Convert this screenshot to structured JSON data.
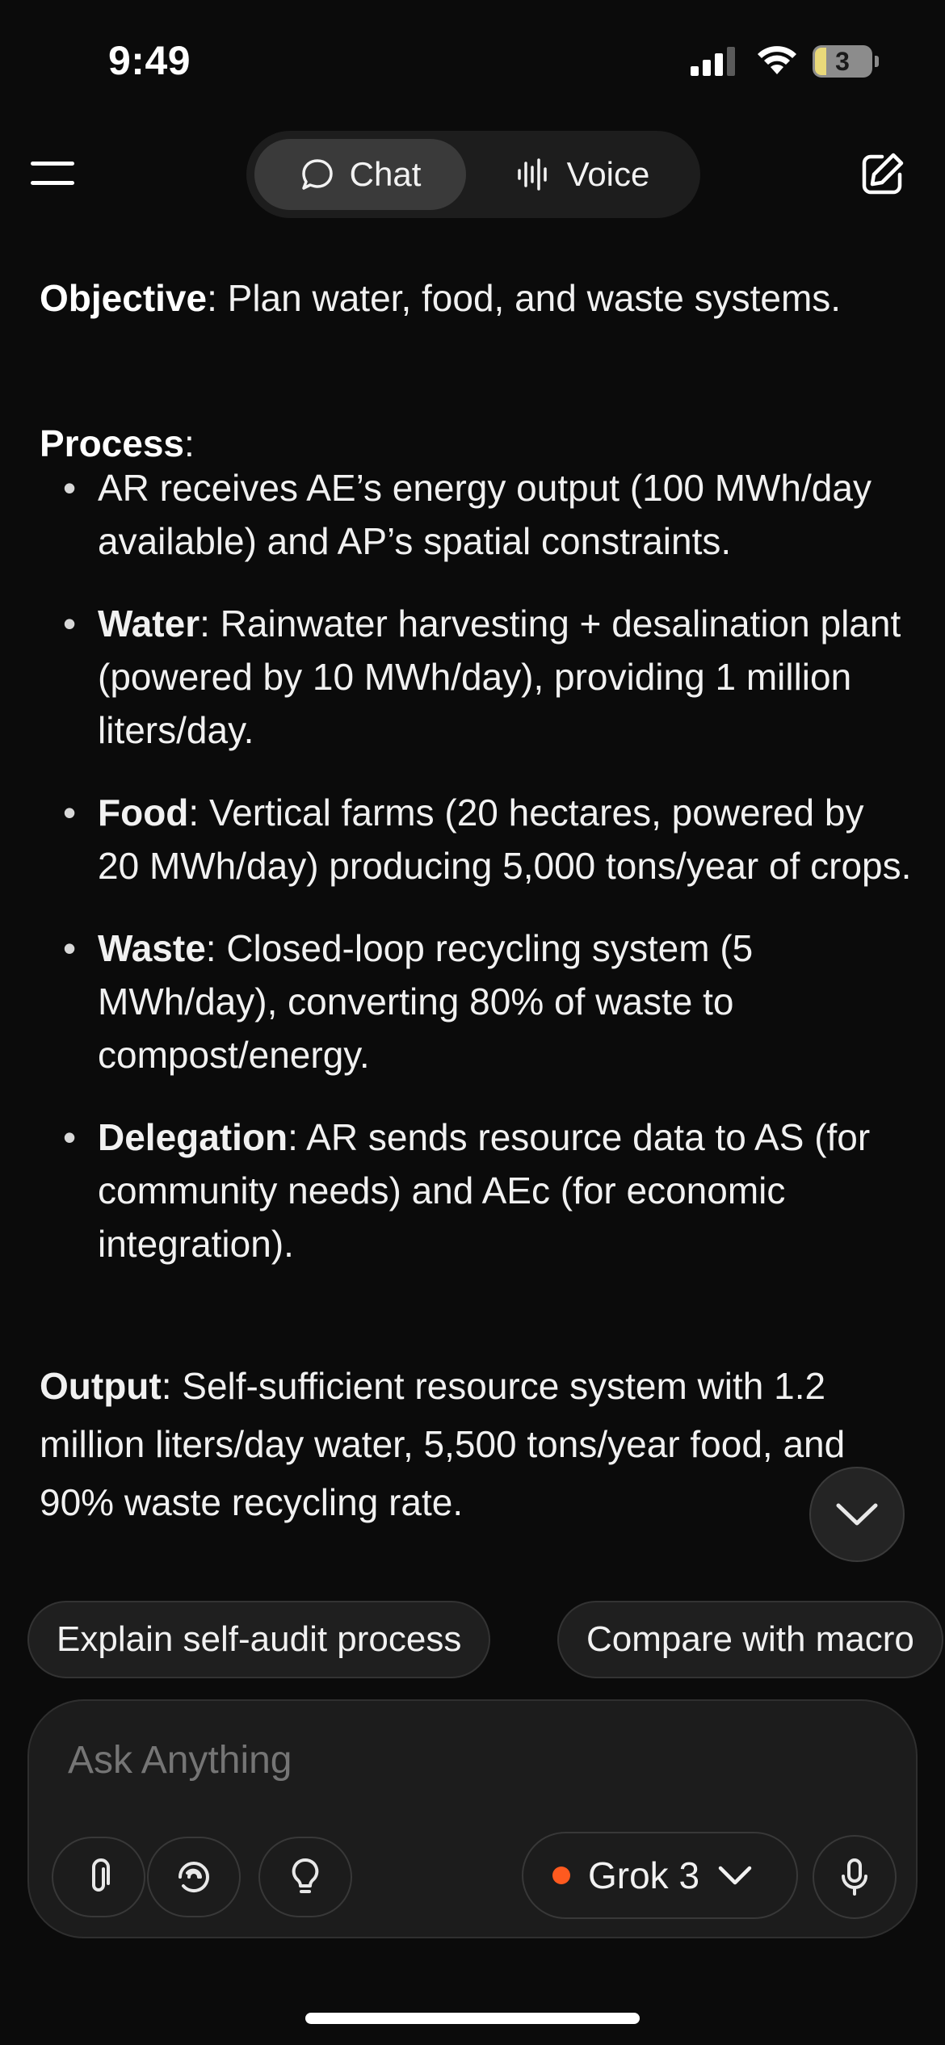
{
  "status_bar": {
    "time": "9:49",
    "battery_level": "3",
    "icons": [
      "cellular-signal-icon",
      "wifi-icon",
      "battery-icon"
    ]
  },
  "header": {
    "menu_icon": "hamburger-menu-icon",
    "tabs": [
      {
        "label": "Chat",
        "icon": "chat-bubble-icon",
        "selected": true
      },
      {
        "label": "Voice",
        "icon": "waveform-icon",
        "selected": false
      }
    ],
    "new_chat_icon": "compose-icon"
  },
  "message": {
    "objective": {
      "label": "Objective",
      "text": ": Plan water, food, and waste systems."
    },
    "process": {
      "label": "Process",
      "text": ":"
    },
    "bullets": [
      {
        "label": "",
        "text": "AR receives AE’s energy output (100 MWh/day available) and AP’s spatial constraints."
      },
      {
        "label": "Water",
        "text": ": Rainwater harvesting + desalination plant (powered by 10 MWh/day), providing 1 million liters/day."
      },
      {
        "label": "Food",
        "text": ": Vertical farms (20 hectares, powered by 20 MWh/day) producing 5,000 tons/year of crops."
      },
      {
        "label": "Waste",
        "text": ": Closed-loop recycling system (5 MWh/day), converting 80% of waste to compost/energy."
      },
      {
        "label": "Delegation",
        "text": ": AR sends resource data to AS (for community needs) and AEc (for economic integration)."
      }
    ],
    "output": {
      "label": "Output",
      "text": ": Self-sufficient resource system with 1.2 million liters/day water, 5,500 tons/year food, and 90% waste recycling rate."
    }
  },
  "scroll_down_icon": "chevron-down-icon",
  "suggestions": [
    "Explain self-audit process",
    "Compare with macro"
  ],
  "composer": {
    "placeholder": "Ask Anything",
    "tools": [
      "paperclip-icon",
      "deep-search-icon",
      "lightbulb-icon"
    ],
    "model": {
      "label": "Grok 3",
      "status_color": "#ff5a1f"
    },
    "mic_icon": "microphone-icon"
  },
  "colors": {
    "background": "#0b0b0b",
    "accent": "#ff5a1f"
  }
}
